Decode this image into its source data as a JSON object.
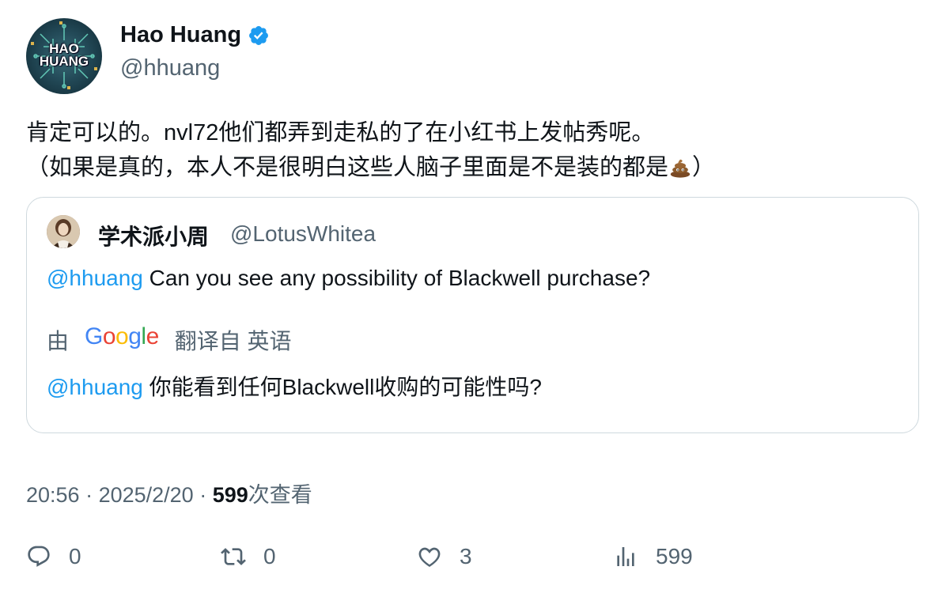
{
  "author": {
    "display_name": "Hao Huang",
    "handle": "@hhuang",
    "avatar_text_1": "HAO",
    "avatar_text_2": "HUANG"
  },
  "tweet": {
    "line1": "肯定可以的。nvl72他们都弄到走私的了在小红书上发帖秀呢。",
    "line2": "（如果是真的，本人不是很明白这些人脑子里面是不是装的都是",
    "line2_end": "）"
  },
  "quoted": {
    "display_name": "学术派小周",
    "handle": "@LotusWhitea",
    "mention": "@hhuang",
    "text": " Can you see any possibility of Blackwell purchase?",
    "translate_prefix": "由",
    "translate_brand": "Google",
    "translate_suffix": "翻译自 英语",
    "translated_mention": "@hhuang",
    "translated_text": " 你能看到任何Blackwell收购的可能性吗?"
  },
  "meta": {
    "time": "20:56",
    "sep1": " · ",
    "date": "2025/2/20",
    "sep2": " · ",
    "views_count": "599",
    "views_label": "次查看"
  },
  "actions": {
    "replies": "0",
    "reposts": "0",
    "likes": "3",
    "views": "599"
  },
  "colors": {
    "accent": "#1d9bf0",
    "secondary_text": "#536471",
    "border": "#cfd9de"
  },
  "icons": [
    "verified-badge-icon",
    "poop-emoji-icon",
    "reply-icon",
    "repost-icon",
    "like-icon",
    "views-icon"
  ]
}
